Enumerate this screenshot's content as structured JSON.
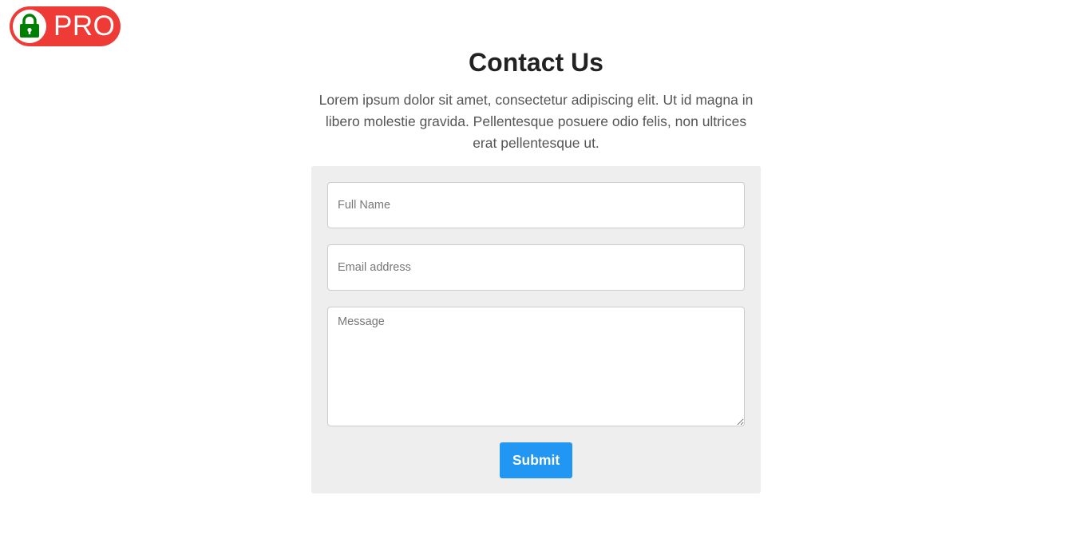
{
  "badge": {
    "label": "PRO",
    "icon": "lock-icon",
    "background_color": "#ef3b36",
    "icon_color": "#008000"
  },
  "header": {
    "title": "Contact Us",
    "intro": "Lorem ipsum dolor sit amet, consectetur adipiscing elit. Ut id magna in libero molestie gravida. Pellentesque posuere odio felis, non ultrices erat pellentesque ut."
  },
  "form": {
    "full_name": {
      "placeholder": "Full Name",
      "value": ""
    },
    "email": {
      "placeholder": "Email address",
      "value": ""
    },
    "message": {
      "placeholder": "Message",
      "value": ""
    },
    "submit_label": "Submit",
    "submit_color": "#2196f3",
    "panel_color": "#eeeeee"
  }
}
